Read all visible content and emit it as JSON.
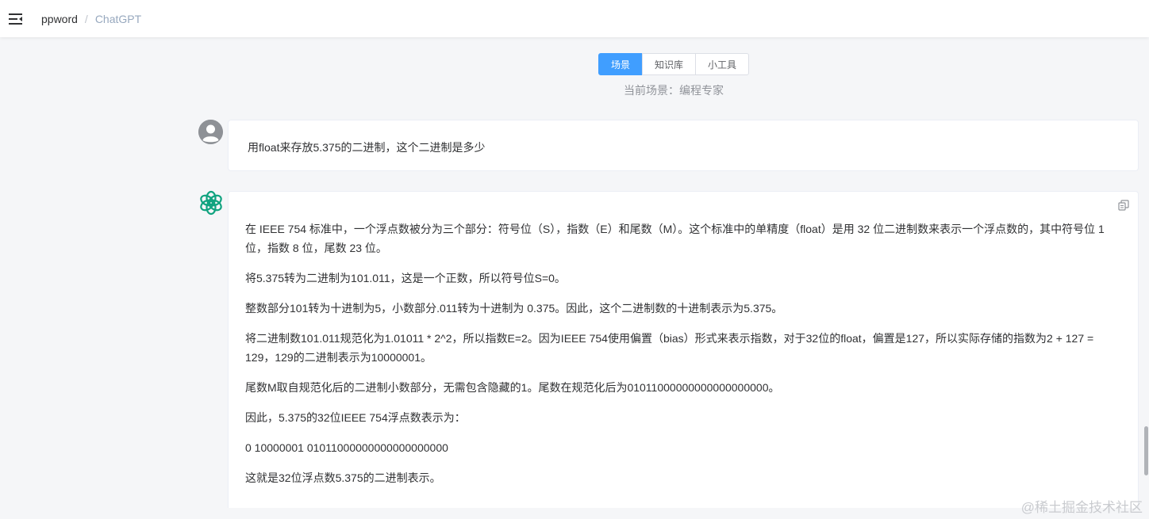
{
  "header": {
    "menu_icon": "menu-fold-icon",
    "breadcrumb": {
      "home": "ppword",
      "separator": "/",
      "current": "ChatGPT"
    }
  },
  "tabs": {
    "items": [
      {
        "label": "场景",
        "active": true
      },
      {
        "label": "知识库",
        "active": false
      },
      {
        "label": "小工具",
        "active": false
      }
    ],
    "accent_color": "#409eff"
  },
  "scene": {
    "label": "当前场景：",
    "value": "编程专家"
  },
  "conversation": {
    "user_message": "用float来存放5.375的二进制，这个二进制是多少",
    "assistant_icon": "openai-logo-icon",
    "assistant_logo_color": "#10a37f",
    "copy_icon": "copy-icon",
    "assistant_paragraphs": [
      "在 IEEE 754 标准中，一个浮点数被分为三个部分：符号位（S），指数（E）和尾数（M）。这个标准中的单精度（float）是用 32 位二进制数来表示一个浮点数的，其中符号位 1 位，指数 8 位，尾数 23 位。",
      "将5.375转为二进制为101.011，这是一个正数，所以符号位S=0。",
      "整数部分101转为十进制为5，小数部分.011转为十进制为 0.375。因此，这个二进制数的十进制表示为5.375。",
      "将二进制数101.011规范化为1.01011 * 2^2，所以指数E=2。因为IEEE 754使用偏置（bias）形式来表示指数，对于32位的float，偏置是127，所以实际存储的指数为2 + 127 = 129，129的二进制表示为10000001。",
      "尾数M取自规范化后的二进制小数部分，无需包含隐藏的1。尾数在规范化后为01011000000000000000000。",
      "因此，5.375的32位IEEE 754浮点数表示为：",
      "0 10000001 01011000000000000000000",
      "这就是32位浮点数5.375的二进制表示。"
    ]
  },
  "watermark": "@稀土掘金技术社区"
}
